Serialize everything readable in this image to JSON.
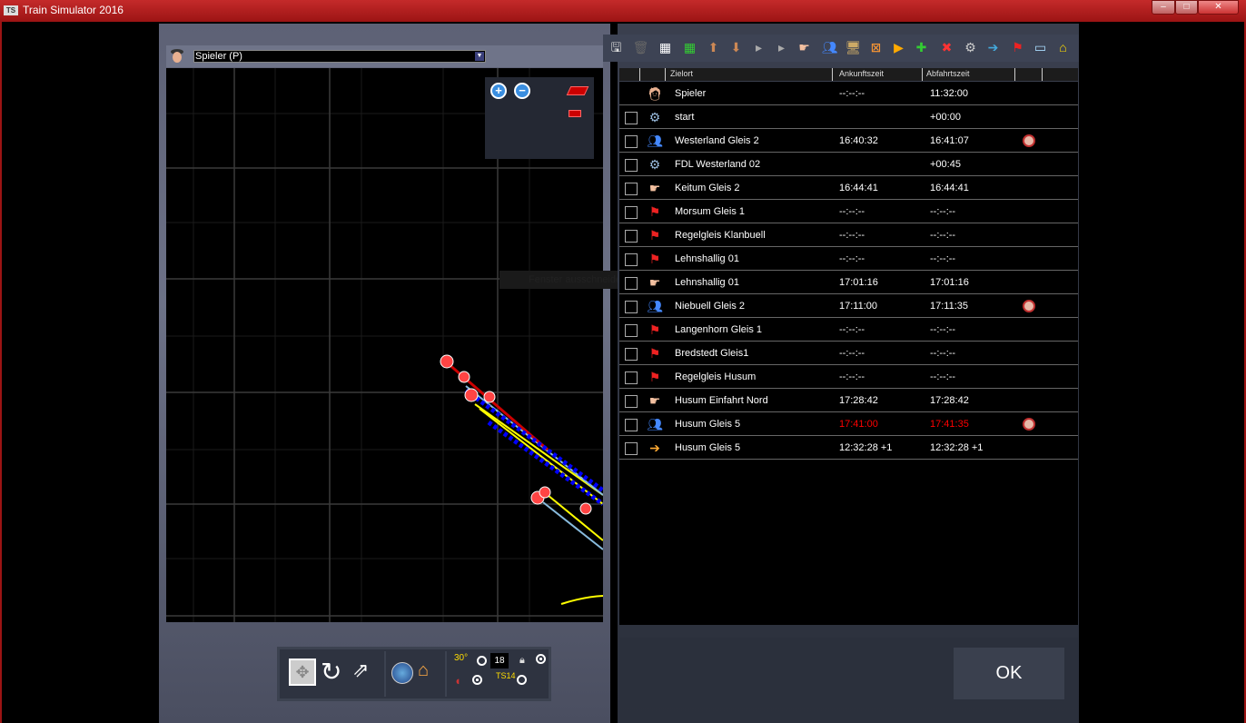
{
  "window": {
    "title": "Train Simulator 2016",
    "logo": "TS",
    "min": "–",
    "max": "□",
    "close": "✕"
  },
  "map": {
    "driver_select": "Spieler (P)",
    "tooltip": "Fenster ausschneiden"
  },
  "bottom_toolbar": {
    "angle_label": "30°",
    "number": "18",
    "ts_label": "TS14"
  },
  "table": {
    "headers": {
      "destination": "Zielort",
      "arrival": "Ankunftszeit",
      "departure": "Abfahrtszeit"
    },
    "rows": [
      {
        "icon": "player",
        "name": "Spieler",
        "arr": "--:--:--",
        "dep": "11:32:00",
        "checkbox": false,
        "alarm": false
      },
      {
        "icon": "script",
        "name": "start",
        "arr": "",
        "dep": "+00:00",
        "checkbox": true,
        "alarm": false
      },
      {
        "icon": "passengers",
        "name": "Westerland Gleis 2",
        "arr": "16:40:32",
        "dep": "16:41:07",
        "checkbox": true,
        "alarm": true
      },
      {
        "icon": "script",
        "name": "FDL Westerland 02",
        "arr": "",
        "dep": "+00:45",
        "checkbox": true,
        "alarm": false
      },
      {
        "icon": "hand",
        "name": "Keitum Gleis 2",
        "arr": "16:44:41",
        "dep": "16:44:41",
        "checkbox": true,
        "alarm": false
      },
      {
        "icon": "flag",
        "name": "Morsum Gleis 1",
        "arr": "--:--:--",
        "dep": "--:--:--",
        "checkbox": true,
        "alarm": false
      },
      {
        "icon": "flag",
        "name": "Regelgleis Klanbuell",
        "arr": "--:--:--",
        "dep": "--:--:--",
        "checkbox": true,
        "alarm": false
      },
      {
        "icon": "flag",
        "name": "Lehnshallig 01",
        "arr": "--:--:--",
        "dep": "--:--:--",
        "checkbox": true,
        "alarm": false
      },
      {
        "icon": "hand",
        "name": "Lehnshallig 01",
        "arr": "17:01:16",
        "dep": "17:01:16",
        "checkbox": true,
        "alarm": false
      },
      {
        "icon": "passengers",
        "name": "Niebuell Gleis 2",
        "arr": "17:11:00",
        "dep": "17:11:35",
        "checkbox": true,
        "alarm": true
      },
      {
        "icon": "flag",
        "name": "Langenhorn Gleis 1",
        "arr": "--:--:--",
        "dep": "--:--:--",
        "checkbox": true,
        "alarm": false
      },
      {
        "icon": "flag",
        "name": "Bredstedt Gleis1",
        "arr": "--:--:--",
        "dep": "--:--:--",
        "checkbox": true,
        "alarm": false
      },
      {
        "icon": "flag",
        "name": "Regelgleis Husum",
        "arr": "--:--:--",
        "dep": "--:--:--",
        "checkbox": true,
        "alarm": false
      },
      {
        "icon": "hand",
        "name": "Husum Einfahrt Nord",
        "arr": "17:28:42",
        "dep": "17:28:42",
        "checkbox": true,
        "alarm": false
      },
      {
        "icon": "passengers",
        "name": "Husum Gleis 5",
        "arr": "17:41:00",
        "dep": "17:41:35",
        "checkbox": true,
        "alarm": true,
        "late": true
      },
      {
        "icon": "exit",
        "name": "Husum Gleis 5",
        "arr": "12:32:28 +1",
        "dep": "12:32:28 +1",
        "checkbox": true,
        "alarm": false
      }
    ]
  },
  "ok_label": "OK",
  "colors": {
    "titlebar": "#b81c1c",
    "late": "#ff0000"
  }
}
